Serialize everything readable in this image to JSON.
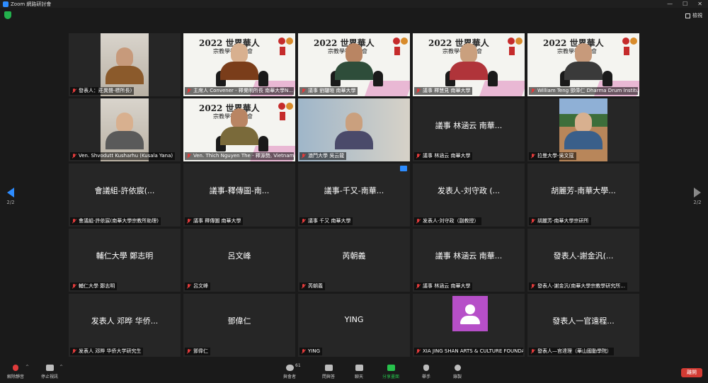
{
  "window": {
    "title": "Zoom 網路研討會"
  },
  "topbar": {
    "view_label": "檢視"
  },
  "pager": {
    "left_page": "2/2",
    "right_page": "2/2"
  },
  "tiles": [
    {
      "label": "發表人：莊異聲-標所長)",
      "center": "",
      "type": "photo"
    },
    {
      "label": "主席人 Convener - 釋覺明所長 南華大學N...",
      "center": "",
      "type": "banner",
      "active": true
    },
    {
      "label": "議事 劉驪暄 南華大學",
      "center": "",
      "type": "banner"
    },
    {
      "label": "議事 釋慧見 南華大學",
      "center": "",
      "type": "banner"
    },
    {
      "label": "William Teng 鄧偉仁 Dharma Drum Institute &...",
      "center": "",
      "type": "banner"
    },
    {
      "label": "Ven. Shvodutt Kusharhu (Kusala Yana)",
      "center": "",
      "type": "photo"
    },
    {
      "label": "Ven. Thich Nguyen The - 釋源勢, Vietnam",
      "center": "",
      "type": "banner"
    },
    {
      "label": "澳門大學 吳云龍",
      "center": "",
      "type": "photo"
    },
    {
      "label": "議事 林涵云 南華大學",
      "center": "議事 林涵云 南華...",
      "type": "name"
    },
    {
      "label": "拉曼大學-吳文寇",
      "center": "",
      "type": "photo"
    },
    {
      "label": "會議組-許依宸(南華大學宗教所助理)",
      "center": "會議組-許依宸(...",
      "type": "name"
    },
    {
      "label": "議事 釋傳圖 南華大學",
      "center": "議事-釋傳圖-南...",
      "type": "name"
    },
    {
      "label": "議事 千又 南華大學",
      "center": "議事-千又-南華...",
      "type": "name",
      "cam": true
    },
    {
      "label": "发表人-刘守政（副教授）",
      "center": "发表人-刘守政 (...",
      "type": "name"
    },
    {
      "label": "胡麗芳-南華大學宗研所",
      "center": "胡麗芳-南華大學...",
      "type": "name"
    },
    {
      "label": "輔仁大學 鄭志明",
      "center": "輔仁大學 鄭志明",
      "type": "name"
    },
    {
      "label": "呂文峰",
      "center": "呂文峰",
      "type": "name"
    },
    {
      "label": "芮朝義",
      "center": "芮朝義",
      "type": "name"
    },
    {
      "label": "議事 林涵云 南華大學",
      "center": "議事 林涵云 南華...",
      "type": "name"
    },
    {
      "label": "發表人-謝金汎(南華大學宗教學研究所...",
      "center": "發表人-謝金汎(...",
      "type": "name"
    },
    {
      "label": "发表人 邓晔 华侨大学研究生",
      "center": "发表人 邓晔 华侨...",
      "type": "name"
    },
    {
      "label": "鄧偉仁",
      "center": "鄧偉仁",
      "type": "name"
    },
    {
      "label": "YING",
      "center": "YING",
      "type": "name"
    },
    {
      "label": "XIA JING SHAN ARTS & CULTURE FOUNDATION",
      "center": "",
      "type": "avatar"
    },
    {
      "label": "發表人—官達理（華山國動學院）",
      "center": "發表人一官遠程...",
      "type": "name"
    }
  ],
  "banner": {
    "title": "2022 世界華人",
    "subtitle": "宗教學術研討會"
  },
  "toolbar": {
    "mute": "解除靜音",
    "video": "停止視訊",
    "participants": "與會者",
    "participants_count": "61",
    "qa": "問與答",
    "chat": "聊天",
    "share": "分享畫面",
    "raise": "舉手",
    "record": "錄製",
    "leave": "離開"
  },
  "colors": {
    "accent": "#2d8cff",
    "active_speaker": "#7ee32a",
    "share_green": "#27c24c",
    "leave_red": "#d33b33",
    "avatar_purple": "#b64fc8"
  }
}
